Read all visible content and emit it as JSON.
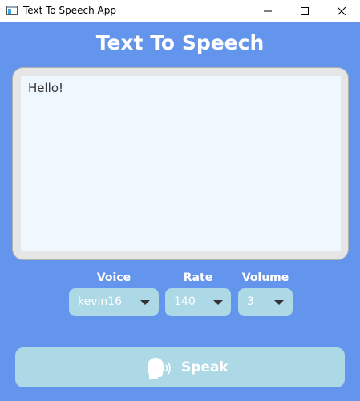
{
  "window": {
    "title": "Text To Speech App"
  },
  "app": {
    "heading": "Text To Speech",
    "text_value": "Hello!"
  },
  "controls": {
    "voice": {
      "label": "Voice",
      "value": "kevin16"
    },
    "rate": {
      "label": "Rate",
      "value": "140"
    },
    "volume": {
      "label": "Volume",
      "value": "3"
    }
  },
  "speak_button": {
    "label": "Speak",
    "icon": "speaking-head-icon"
  },
  "colors": {
    "background": "#6495ed",
    "text_area": "#f0f8ff",
    "control": "#add8e6",
    "text_on_accent": "#ffffff"
  }
}
